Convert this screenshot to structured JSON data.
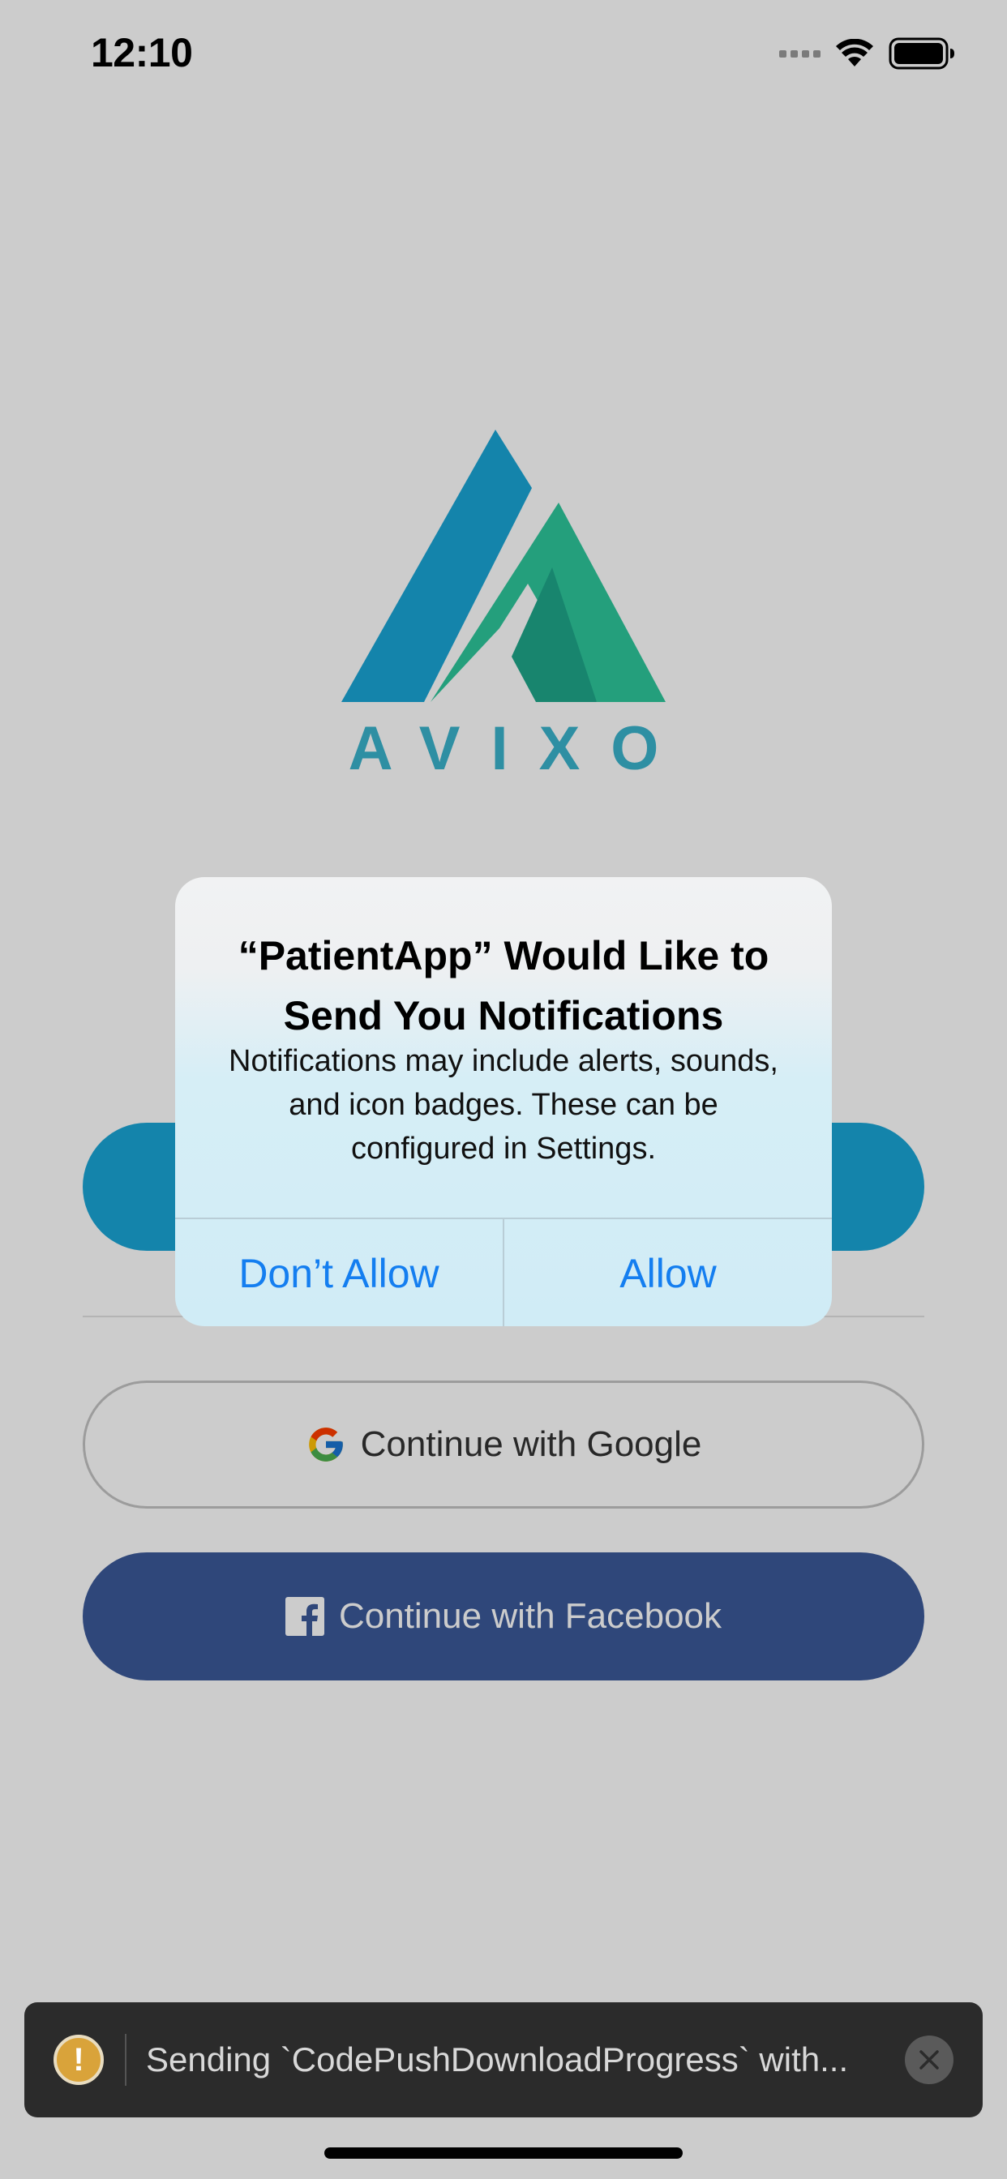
{
  "status_bar": {
    "time": "12:10",
    "wifi_icon": "wifi-icon",
    "battery_icon": "battery-icon"
  },
  "app": {
    "logo_text": "AVIXO",
    "colors": {
      "logo_blue": "#1aa6d6",
      "logo_green": "#2dc79b",
      "logo_dark_green": "#1fa78a",
      "primary_button": "#1aa6d6",
      "facebook_button": "#3b5999"
    }
  },
  "login": {
    "google_label": "Continue with Google",
    "google_icon": "google-icon",
    "facebook_label": "Continue with Facebook",
    "facebook_icon": "facebook-icon"
  },
  "alert": {
    "title": "“PatientApp” Would Like to Send You Notifications",
    "message": "Notifications may include alerts, sounds, and icon badges. These can be configured in Settings.",
    "dont_allow_label": "Don’t Allow",
    "allow_label": "Allow",
    "button_color": "#147ef0"
  },
  "toast": {
    "icon_label": "!",
    "message": "Sending `CodePushDownloadProgress` with..."
  }
}
